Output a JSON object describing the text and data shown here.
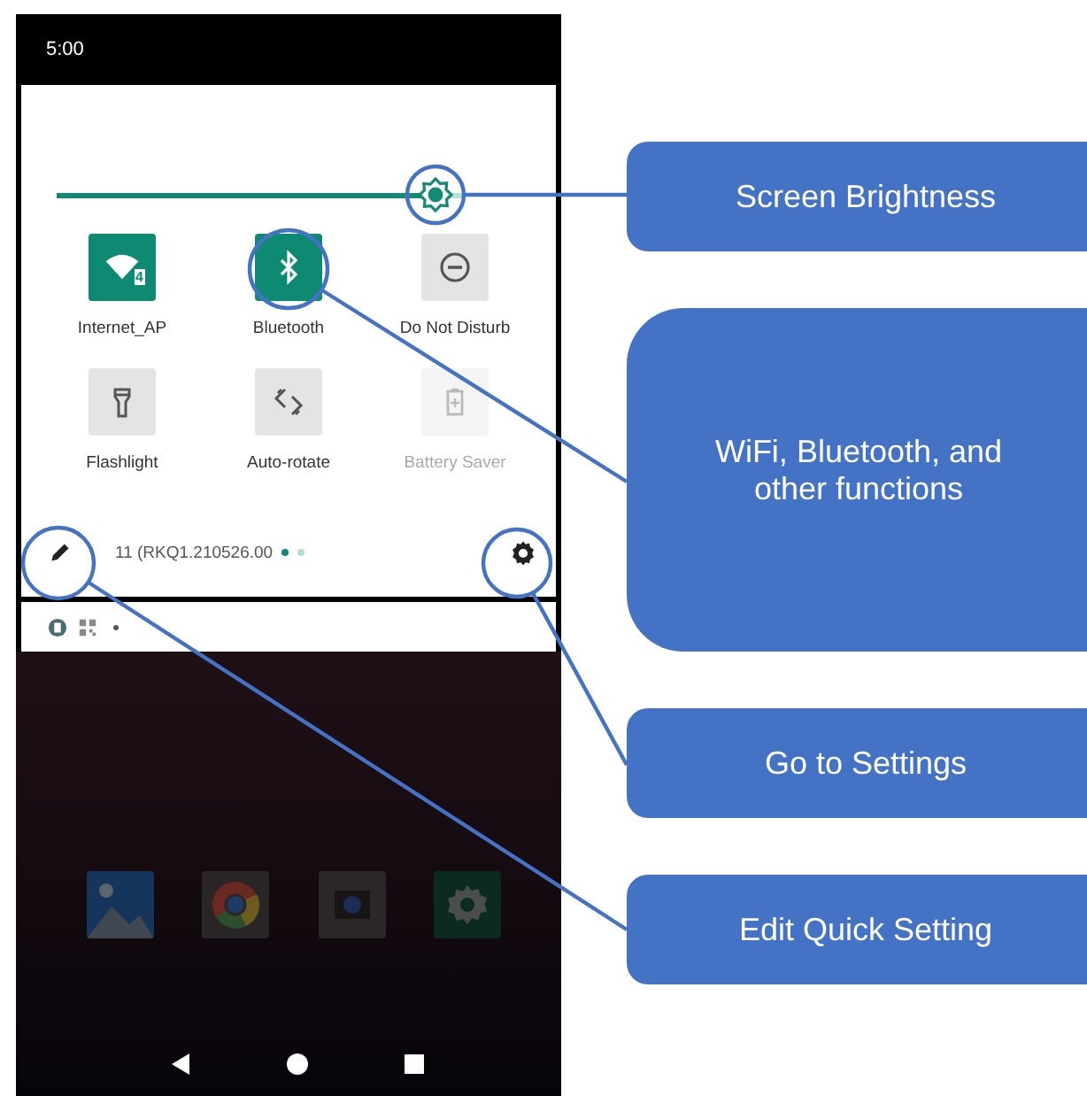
{
  "status_bar": {
    "time": "5:00"
  },
  "quick_settings": {
    "brightness": {
      "level": 0.93
    },
    "tiles": [
      {
        "label": "Internet_AP",
        "kind": "wifi",
        "on": true,
        "disabled": false,
        "badge": "4"
      },
      {
        "label": "Bluetooth",
        "kind": "bluetooth",
        "on": true,
        "disabled": false
      },
      {
        "label": "Do Not Disturb",
        "kind": "dnd",
        "on": false,
        "disabled": false
      },
      {
        "label": "Flashlight",
        "kind": "flashlight",
        "on": false,
        "disabled": false
      },
      {
        "label": "Auto-rotate",
        "kind": "rotate",
        "on": false,
        "disabled": false
      },
      {
        "label": "Battery Saver",
        "kind": "battery",
        "on": false,
        "disabled": true
      }
    ],
    "build_number": "11 (RKQ1.210526.00",
    "page_dots": [
      {
        "selected": true
      },
      {
        "selected": false
      }
    ]
  },
  "callouts": [
    {
      "text": "Screen Brightness"
    },
    {
      "text": "WiFi, Bluetooth, and other functions"
    },
    {
      "text": "Go to Settings"
    },
    {
      "text": "Edit Quick Setting"
    }
  ]
}
